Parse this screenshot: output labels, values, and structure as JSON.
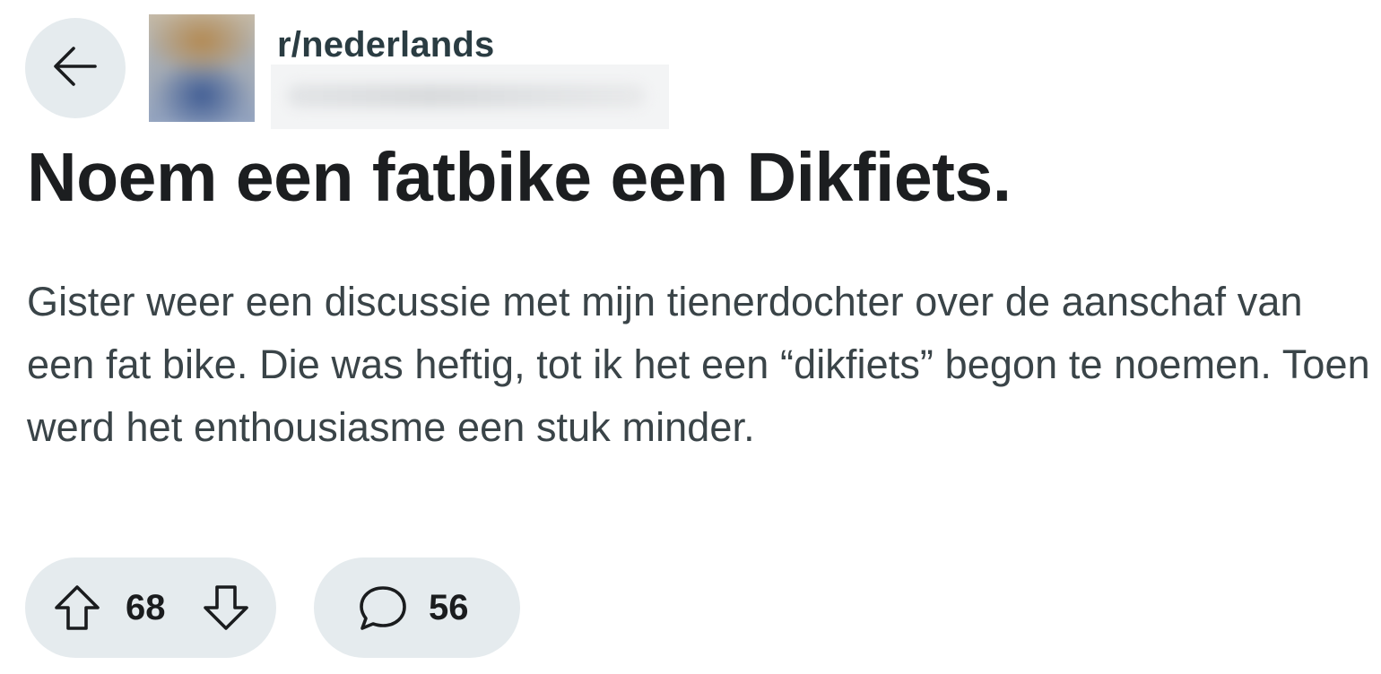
{
  "header": {
    "back_icon": "arrow-left-icon",
    "subreddit": "r/nederlands",
    "avatar_icon": "blurred-avatar",
    "username_redacted": true
  },
  "post": {
    "title": "Noem een fatbike een Dikfiets.",
    "body": "Gister weer een discussie met mijn tienerdochter over de aanschaf van een fat bike. Die was heftig, tot ik het een “dikfiets” begon te noemen. Toen werd het enthousiasme een stuk minder."
  },
  "actions": {
    "upvote_icon": "arrow-up-icon",
    "score": "68",
    "downvote_icon": "arrow-down-icon",
    "comment_icon": "speech-bubble-icon",
    "comment_count": "56"
  },
  "colors": {
    "pill_background": "#e5ebee",
    "title_text": "#1c1e20",
    "body_text": "#3a4448",
    "subreddit_text": "#2a3c42"
  }
}
